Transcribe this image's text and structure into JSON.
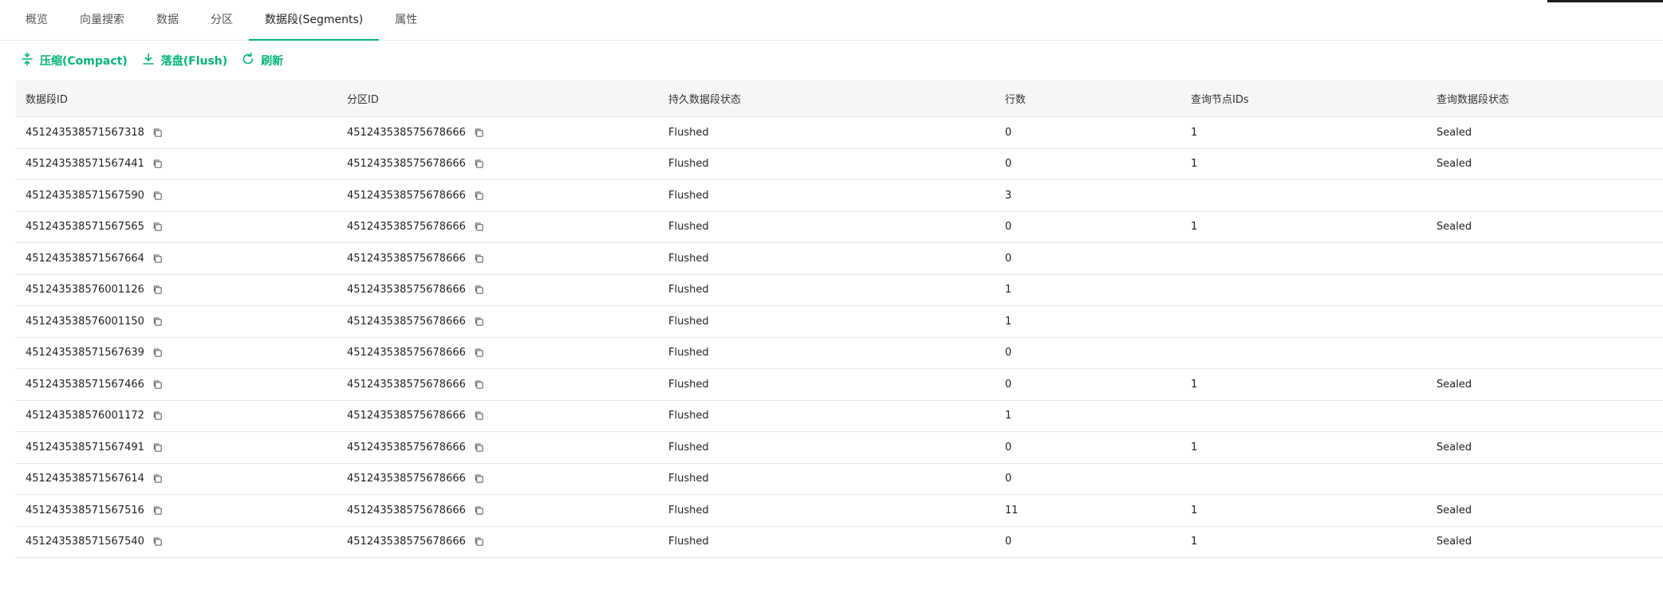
{
  "tabs": [
    {
      "label": "概览"
    },
    {
      "label": "向量搜索"
    },
    {
      "label": "数据"
    },
    {
      "label": "分区"
    },
    {
      "label": "数据段(Segments)",
      "active": true
    },
    {
      "label": "属性"
    }
  ],
  "toolbar": {
    "compact_label": "压缩(Compact)",
    "flush_label": "落盘(Flush)",
    "refresh_label": "刷新"
  },
  "colors": {
    "accent": "#06b37b"
  },
  "table": {
    "columns": [
      "数据段ID",
      "分区ID",
      "持久数据段状态",
      "行数",
      "查询节点IDs",
      "查询数据段状态"
    ],
    "rows": [
      {
        "segment_id": "451243538571567318",
        "partition_id": "451243538575678666",
        "persist_state": "Flushed",
        "rows": "0",
        "query_node_ids": "1",
        "query_state": "Sealed"
      },
      {
        "segment_id": "451243538571567441",
        "partition_id": "451243538575678666",
        "persist_state": "Flushed",
        "rows": "0",
        "query_node_ids": "1",
        "query_state": "Sealed"
      },
      {
        "segment_id": "451243538571567590",
        "partition_id": "451243538575678666",
        "persist_state": "Flushed",
        "rows": "3",
        "query_node_ids": "",
        "query_state": ""
      },
      {
        "segment_id": "451243538571567565",
        "partition_id": "451243538575678666",
        "persist_state": "Flushed",
        "rows": "0",
        "query_node_ids": "1",
        "query_state": "Sealed"
      },
      {
        "segment_id": "451243538571567664",
        "partition_id": "451243538575678666",
        "persist_state": "Flushed",
        "rows": "0",
        "query_node_ids": "",
        "query_state": ""
      },
      {
        "segment_id": "451243538576001126",
        "partition_id": "451243538575678666",
        "persist_state": "Flushed",
        "rows": "1",
        "query_node_ids": "",
        "query_state": ""
      },
      {
        "segment_id": "451243538576001150",
        "partition_id": "451243538575678666",
        "persist_state": "Flushed",
        "rows": "1",
        "query_node_ids": "",
        "query_state": ""
      },
      {
        "segment_id": "451243538571567639",
        "partition_id": "451243538575678666",
        "persist_state": "Flushed",
        "rows": "0",
        "query_node_ids": "",
        "query_state": ""
      },
      {
        "segment_id": "451243538571567466",
        "partition_id": "451243538575678666",
        "persist_state": "Flushed",
        "rows": "0",
        "query_node_ids": "1",
        "query_state": "Sealed"
      },
      {
        "segment_id": "451243538576001172",
        "partition_id": "451243538575678666",
        "persist_state": "Flushed",
        "rows": "1",
        "query_node_ids": "",
        "query_state": ""
      },
      {
        "segment_id": "451243538571567491",
        "partition_id": "451243538575678666",
        "persist_state": "Flushed",
        "rows": "0",
        "query_node_ids": "1",
        "query_state": "Sealed"
      },
      {
        "segment_id": "451243538571567614",
        "partition_id": "451243538575678666",
        "persist_state": "Flushed",
        "rows": "0",
        "query_node_ids": "",
        "query_state": ""
      },
      {
        "segment_id": "451243538571567516",
        "partition_id": "451243538575678666",
        "persist_state": "Flushed",
        "rows": "11",
        "query_node_ids": "1",
        "query_state": "Sealed"
      },
      {
        "segment_id": "451243538571567540",
        "partition_id": "451243538575678666",
        "persist_state": "Flushed",
        "rows": "0",
        "query_node_ids": "1",
        "query_state": "Sealed"
      }
    ]
  }
}
